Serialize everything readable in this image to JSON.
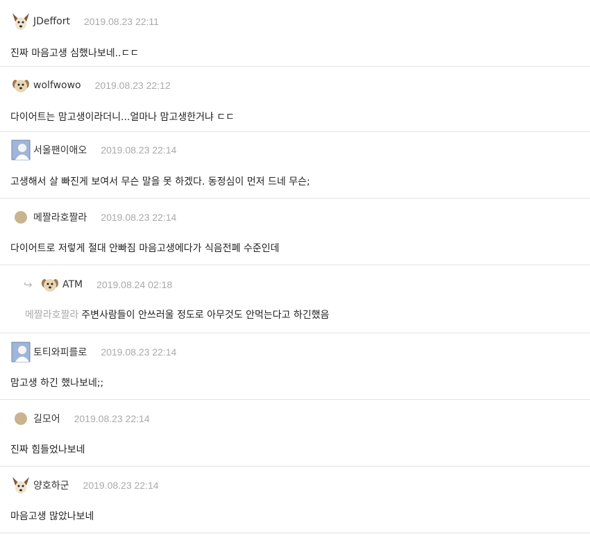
{
  "comments": [
    {
      "nick": "JDeffort",
      "date": "2019.08.23 22:11",
      "text": "진짜 마음고생 심했나보네..ㄷㄷ",
      "avatar": "dog-icon"
    },
    {
      "nick": "wolfwowo",
      "date": "2019.08.23 22:12",
      "text": "다이어트는 맘고생이라더니...얼마나 맘고생한거냐 ㄷㄷ",
      "avatar": "puppy-icon"
    },
    {
      "nick": "서울팬이애오",
      "date": "2019.08.23 22:14",
      "text": "고생해서 살 빠진게 보여서 무슨 말을 못 하겠다. 동정심이 먼저 드네 무슨;",
      "avatar": "profile-photo-icon"
    },
    {
      "nick": "메짤라호짤라",
      "date": "2019.08.23 22:14",
      "text": "다이어트로 저렇게 절대 안빠짐 마음고생에다가 식음전폐 수준인데",
      "avatar": "circle-icon"
    },
    {
      "nick": "ATM",
      "date": "2019.08.24 02:18",
      "mention": "메짤라호짤라",
      "text": "주변사람들이 안쓰러울 정도로 아무것도 안먹는다고 하긴했음",
      "avatar": "puppy-icon",
      "reply_icon": "reply-arrow-icon",
      "reply_glyph": "↪"
    },
    {
      "nick": "토티와피를로",
      "date": "2019.08.23 22:14",
      "text": "맘고생 하긴 했나보네;;",
      "avatar": "profile-photo-icon"
    },
    {
      "nick": "길모어",
      "date": "2019.08.23 22:14",
      "text": "진짜 힘들었나보네",
      "avatar": "circle-icon"
    },
    {
      "nick": "양호하군",
      "date": "2019.08.23 22:14",
      "text": "마음고생 많았나보네",
      "avatar": "dog-icon"
    }
  ],
  "colors": {
    "divider": "#e3e3e3",
    "date": "#a9a9a9",
    "mention": "#aaaaaa"
  }
}
